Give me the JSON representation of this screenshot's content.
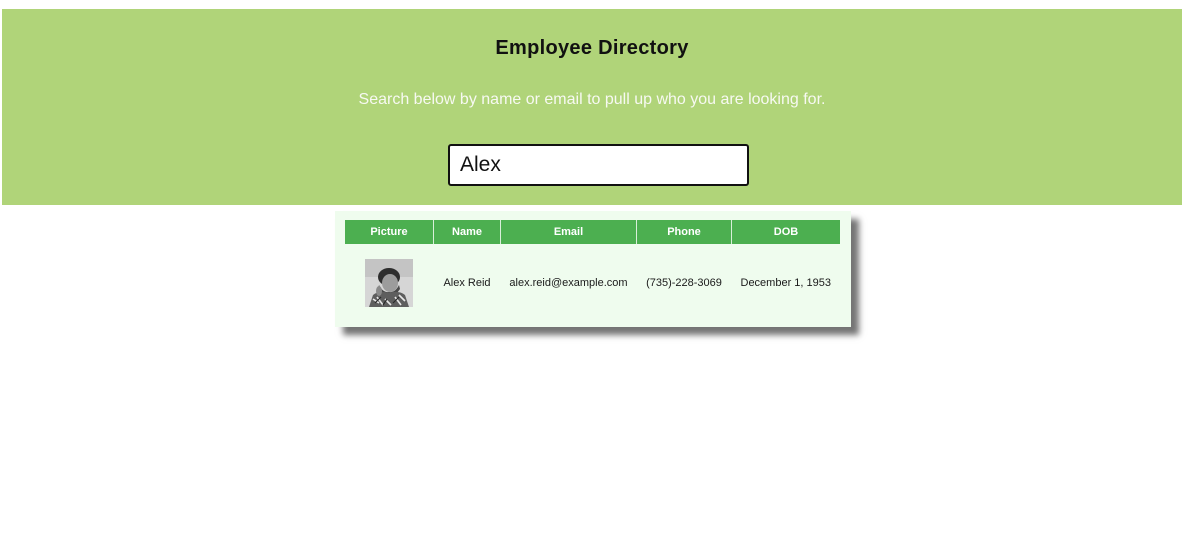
{
  "header": {
    "title": "Employee Directory",
    "subtitle": "Search below by name or email to pull up who you are looking for."
  },
  "search": {
    "value": "Alex"
  },
  "table": {
    "columns": [
      "Picture",
      "Name",
      "Email",
      "Phone",
      "DOB"
    ],
    "rows": [
      {
        "picture": "employee-photo",
        "name": "Alex Reid",
        "email": "alex.reid@example.com",
        "phone": "(735)-228-3069",
        "dob": "December 1, 1953"
      }
    ]
  },
  "colors": {
    "header_bg": "#b0d479",
    "table_header_bg": "#4caf50",
    "table_bg": "#effcee"
  }
}
